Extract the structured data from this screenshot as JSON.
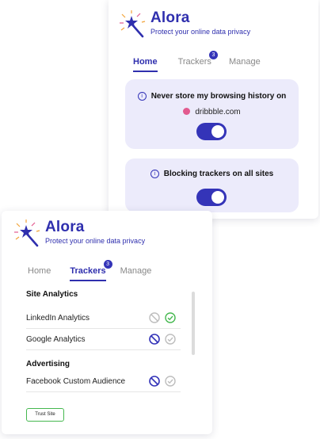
{
  "brand": {
    "name": "Alora",
    "tagline": "Protect your online data privacy"
  },
  "card_home": {
    "tabs": [
      {
        "label": "Home",
        "active": true
      },
      {
        "label": "Trackers",
        "badge": "3"
      },
      {
        "label": "Manage"
      }
    ],
    "history_panel": {
      "title": "Never store my browsing history on",
      "site": "dribbble.com",
      "toggle_on": true
    },
    "blocking_panel": {
      "title": "Blocking trackers on all sites",
      "toggle_on": true
    }
  },
  "card_trackers": {
    "tabs": [
      {
        "label": "Home"
      },
      {
        "label": "Trackers",
        "active": true,
        "badge": "3"
      },
      {
        "label": "Manage"
      }
    ],
    "sections": [
      {
        "title": "Site Analytics",
        "items": [
          {
            "name": "LinkedIn Analytics",
            "state": "allowed"
          },
          {
            "name": "Google Analytics",
            "state": "blocked"
          }
        ]
      },
      {
        "title": "Advertising",
        "items": [
          {
            "name": "Facebook Custom Audience",
            "state": "blocked"
          }
        ]
      }
    ],
    "trust_button": "Trust Site"
  },
  "colors": {
    "accent": "#3434b8",
    "panel": "#ecebfb",
    "allowed": "#45b84f",
    "inactive": "#bdbdbd",
    "site_dot": "#e25a8f"
  }
}
